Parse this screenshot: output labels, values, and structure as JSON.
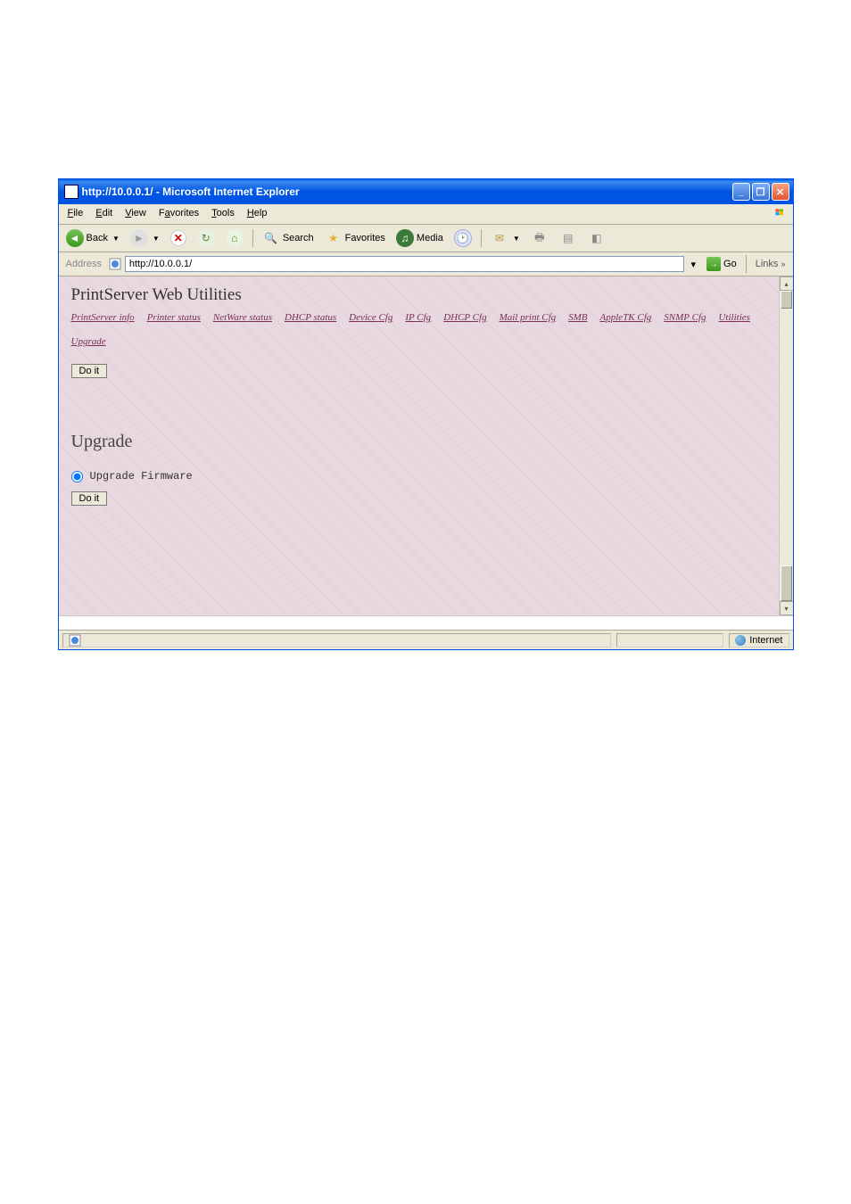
{
  "window": {
    "title": "http://10.0.0.1/ - Microsoft Internet Explorer"
  },
  "menubar": {
    "file": "File",
    "edit": "Edit",
    "view": "View",
    "favorites": "Favorites",
    "tools": "Tools",
    "help": "Help"
  },
  "toolbar": {
    "back": "Back",
    "search": "Search",
    "favorites": "Favorites",
    "media": "Media"
  },
  "addrbar": {
    "label": "Address",
    "value": "http://10.0.0.1/",
    "go": "Go",
    "links": "Links"
  },
  "page": {
    "title": "PrintServer  Web  Utilities",
    "nav": [
      "PrintServer info",
      "Printer status",
      "NetWare status",
      "DHCP status",
      "Device Cfg",
      "IP Cfg",
      "DHCP Cfg",
      "Mail print Cfg",
      "SMB",
      "AppleTK Cfg",
      "SNMP Cfg",
      "Utilities",
      "Upgrade"
    ],
    "doit1": "Do it",
    "section": "Upgrade",
    "radio_label": "Upgrade Firmware",
    "doit2": "Do it"
  },
  "status": {
    "zone": "Internet"
  }
}
